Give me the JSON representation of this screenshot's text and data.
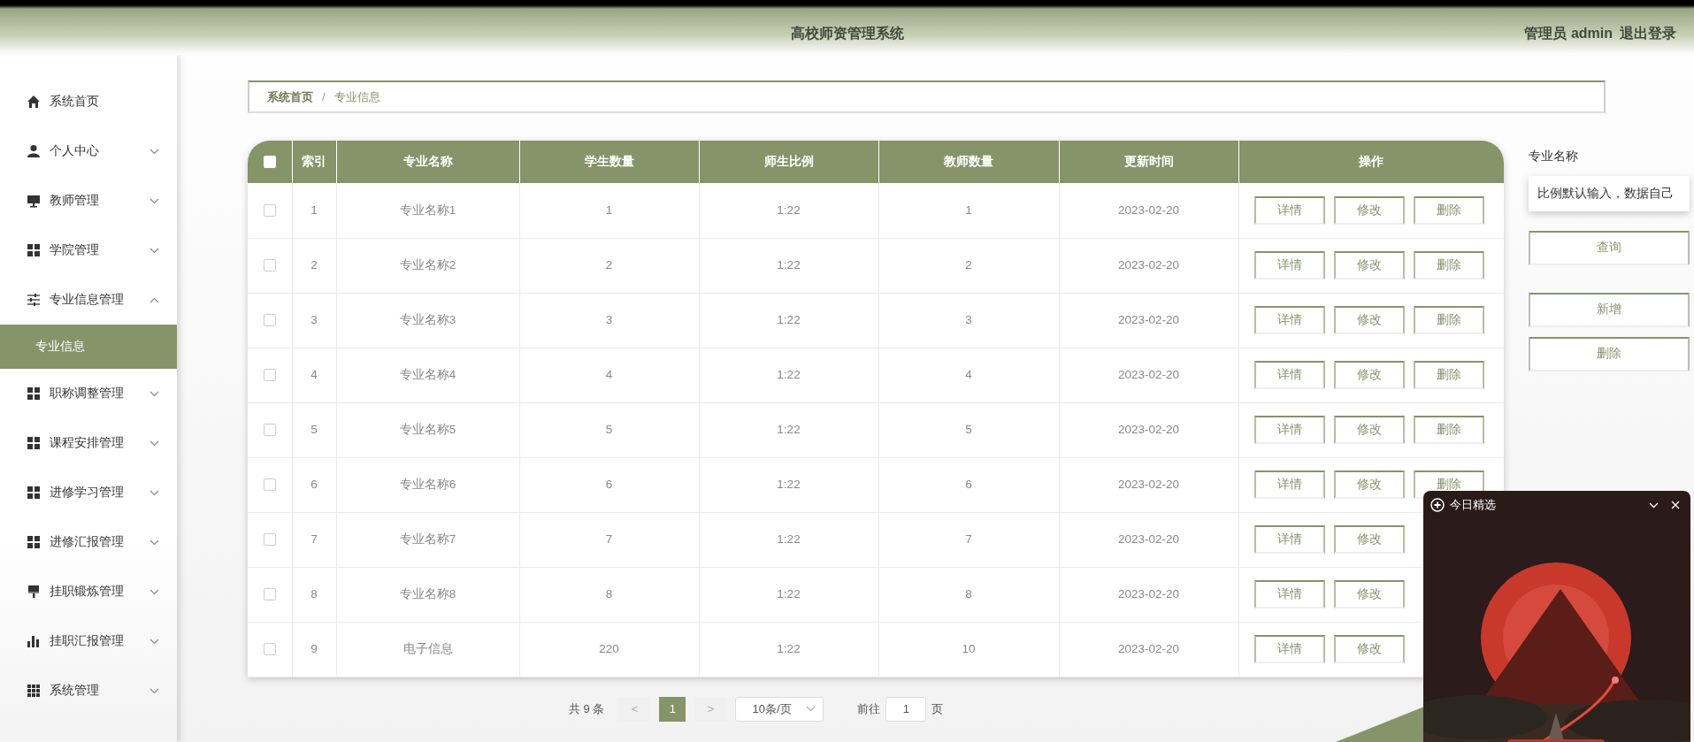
{
  "header": {
    "title": "高校师资管理系统",
    "user": "管理员 admin",
    "logout": "退出登录"
  },
  "sidebar": {
    "items": [
      {
        "label": "系统首页",
        "selected": false
      },
      {
        "label": "个人中心",
        "selected": false,
        "expanded": false
      },
      {
        "label": "教师管理",
        "selected": false,
        "expanded": false
      },
      {
        "label": "学院管理",
        "selected": false,
        "expanded": false
      },
      {
        "label": "专业信息管理",
        "selected": false,
        "expanded": true,
        "children": [
          {
            "label": "专业信息",
            "selected": true
          }
        ]
      },
      {
        "label": "职称调整管理",
        "selected": false,
        "expanded": false
      },
      {
        "label": "课程安排管理",
        "selected": false,
        "expanded": false
      },
      {
        "label": "进修学习管理",
        "selected": false,
        "expanded": false
      },
      {
        "label": "进修汇报管理",
        "selected": false,
        "expanded": false
      },
      {
        "label": "挂职锻炼管理",
        "selected": false,
        "expanded": false
      },
      {
        "label": "挂职汇报管理",
        "selected": false,
        "expanded": false
      },
      {
        "label": "系统管理",
        "selected": false,
        "expanded": false
      }
    ]
  },
  "breadcrumb": {
    "items": [
      "系统首页",
      "专业信息"
    ],
    "separator": "/"
  },
  "table": {
    "all_checked": false,
    "columns": [
      "索引",
      "专业名称",
      "学生数量",
      "师生比例",
      "教师数量",
      "更新时间",
      "操作"
    ],
    "rows": [
      {
        "checked": false,
        "cells": [
          "1",
          "专业名称1",
          "1",
          "1:22",
          "1",
          "2023-02-20"
        ],
        "actions": [
          "详情",
          "修改",
          "删除"
        ]
      },
      {
        "checked": false,
        "cells": [
          "2",
          "专业名称2",
          "2",
          "1:22",
          "2",
          "2023-02-20"
        ],
        "actions": [
          "详情",
          "修改",
          "删除"
        ]
      },
      {
        "checked": false,
        "cells": [
          "3",
          "专业名称3",
          "3",
          "1:22",
          "3",
          "2023-02-20"
        ],
        "actions": [
          "详情",
          "修改",
          "删除"
        ]
      },
      {
        "checked": false,
        "cells": [
          "4",
          "专业名称4",
          "4",
          "1:22",
          "4",
          "2023-02-20"
        ],
        "actions": [
          "详情",
          "修改",
          "删除"
        ]
      },
      {
        "checked": false,
        "cells": [
          "5",
          "专业名称5",
          "5",
          "1:22",
          "5",
          "2023-02-20"
        ],
        "actions": [
          "详情",
          "修改",
          "删除"
        ]
      },
      {
        "checked": false,
        "cells": [
          "6",
          "专业名称6",
          "6",
          "1:22",
          "6",
          "2023-02-20"
        ],
        "actions": [
          "详情",
          "修改",
          "删除"
        ]
      },
      {
        "checked": false,
        "cells": [
          "7",
          "专业名称7",
          "7",
          "1:22",
          "7",
          "2023-02-20"
        ],
        "actions": [
          "详情",
          "修改"
        ]
      },
      {
        "checked": false,
        "cells": [
          "8",
          "专业名称8",
          "8",
          "1:22",
          "8",
          "2023-02-20"
        ],
        "actions": [
          "详情",
          "修改"
        ]
      },
      {
        "checked": false,
        "cells": [
          "9",
          "电子信息",
          "220",
          "1:22",
          "10",
          "2023-02-20"
        ],
        "actions": [
          "详情",
          "修改"
        ]
      }
    ]
  },
  "search": {
    "label": "专业名称",
    "value": "比例默认输入，数据自己",
    "buttons": [
      "查询",
      "新增",
      "删除"
    ]
  },
  "pagination": {
    "total": "共 9 条",
    "prev": "<",
    "pages": [
      {
        "label": "1",
        "selected": true
      }
    ],
    "next": ">",
    "page_size": "10条/页",
    "goto": "前往",
    "goto_value": "1",
    "goto_suffix": "页"
  },
  "popup": {
    "title": "今日精选"
  }
}
